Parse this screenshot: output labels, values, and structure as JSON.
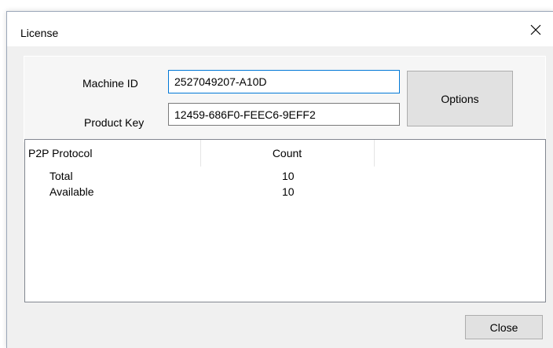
{
  "window": {
    "title": "License"
  },
  "form": {
    "machine_id_label": "Machine ID",
    "machine_id_value": "2527049207-A10D",
    "product_key_label": "Product Key",
    "product_key_value": "12459-686F0-FEEC6-9EFF2",
    "options_label": "Options"
  },
  "list": {
    "columns": [
      "P2P Protocol",
      "Count"
    ],
    "rows": [
      {
        "name": "Total",
        "count": "10"
      },
      {
        "name": "Available",
        "count": "10"
      }
    ]
  },
  "footer": {
    "close_label": "Close"
  },
  "icons": {
    "close": "close-icon"
  }
}
